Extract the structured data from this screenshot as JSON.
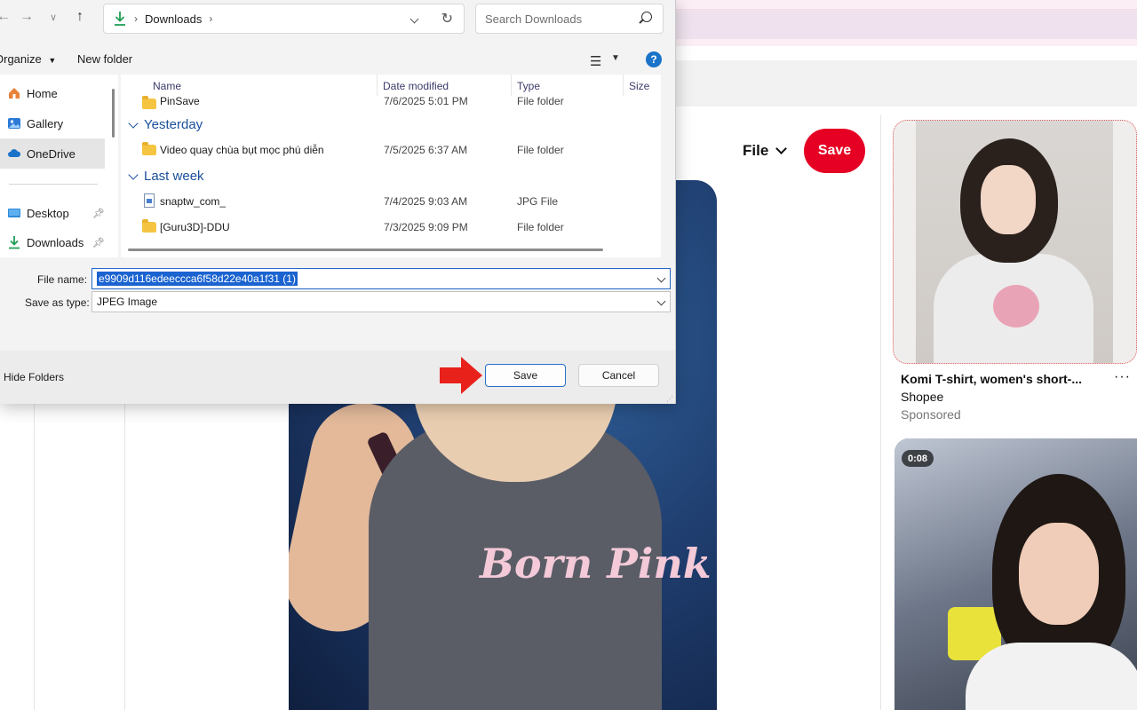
{
  "dialog": {
    "address": {
      "folder": "Downloads"
    },
    "search": {
      "placeholder": "Search Downloads"
    },
    "commands": {
      "organize": "Organize",
      "new_folder": "New folder"
    },
    "nav": {
      "items": [
        {
          "label": "Home",
          "icon": "home-icon"
        },
        {
          "label": "Gallery",
          "icon": "gallery-icon"
        },
        {
          "label": "OneDrive",
          "icon": "cloud-icon",
          "selected": true
        },
        {
          "label": "Desktop",
          "icon": "desktop-icon",
          "pinned": true
        },
        {
          "label": "Downloads",
          "icon": "download-icon",
          "pinned": true
        }
      ]
    },
    "columns": {
      "name": "Name",
      "date": "Date modified",
      "type": "Type",
      "size": "Size"
    },
    "groups": {
      "top_row": {
        "name": "PinSave",
        "date": "7/6/2025 5:01 PM",
        "type": "File folder"
      },
      "yesterday": {
        "label": "Yesterday",
        "rows": [
          {
            "name": "Video quay chùa bụt mọc phú diễn",
            "date": "7/5/2025 6:37 AM",
            "type": "File folder",
            "icon": "folder-icon"
          }
        ]
      },
      "last_week": {
        "label": "Last week",
        "rows": [
          {
            "name": "snaptw_com_",
            "date": "7/4/2025 9:03 AM",
            "type": "JPG File",
            "icon": "jpg-file-icon"
          },
          {
            "name": "[Guru3D]-DDU",
            "date": "7/3/2025 9:09 PM",
            "type": "File folder",
            "icon": "folder-icon"
          }
        ]
      }
    },
    "file_name": {
      "label": "File name:",
      "value": "e9909d116edeeccca6f58d22e40a1f31 (1)"
    },
    "save_as_type": {
      "label": "Save as type:",
      "value": "JPEG Image"
    },
    "footer": {
      "hide_folders": "Hide Folders",
      "save": "Save",
      "cancel": "Cancel"
    }
  },
  "pinterest": {
    "file_menu": "File",
    "save_button": "Save",
    "pin_print_text": "Born Pink",
    "side_pins": [
      {
        "title": "Komi T-shirt, women's short-...",
        "source": "Shopee",
        "sponsored": "Sponsored",
        "more": "···"
      },
      {
        "video_duration": "0:08"
      }
    ]
  },
  "colors": {
    "pinterest_red": "#e60023",
    "accent_blue": "#2470c9",
    "selection_blue": "#1a63d0",
    "arrow_red": "#e8211b"
  }
}
